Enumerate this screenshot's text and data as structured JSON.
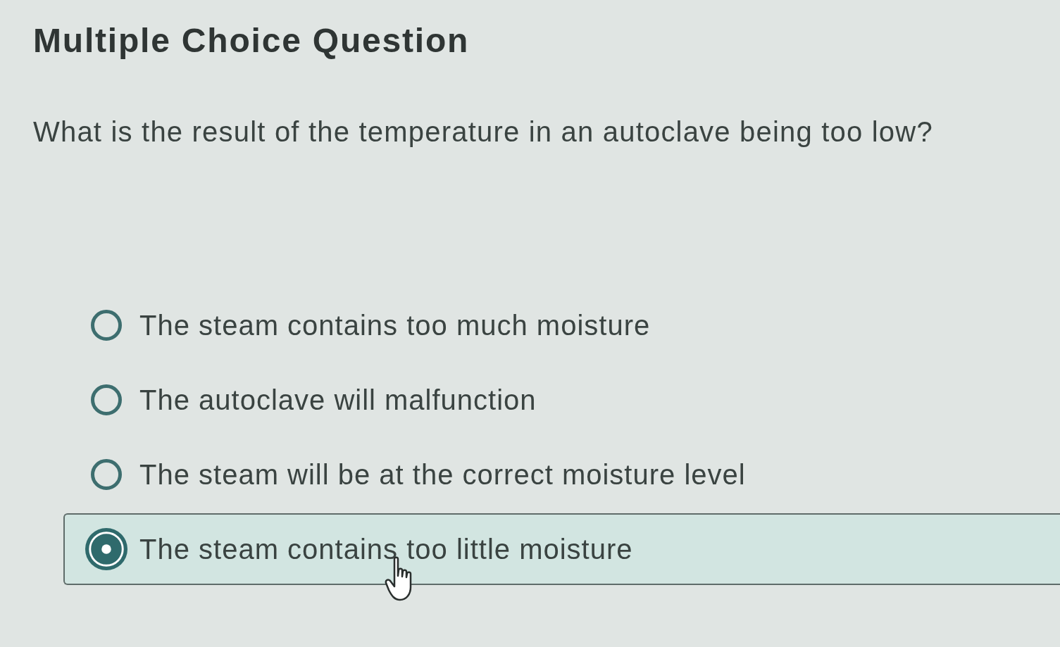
{
  "title": "Multiple Choice Question",
  "question": "What is the result of the temperature in an autoclave being too low?",
  "options": [
    {
      "label": "The steam contains too much moisture",
      "selected": false
    },
    {
      "label": "The autoclave will malfunction",
      "selected": false
    },
    {
      "label": "The steam will be at the correct moisture level",
      "selected": false
    },
    {
      "label": "The steam contains too little moisture",
      "selected": true
    }
  ]
}
